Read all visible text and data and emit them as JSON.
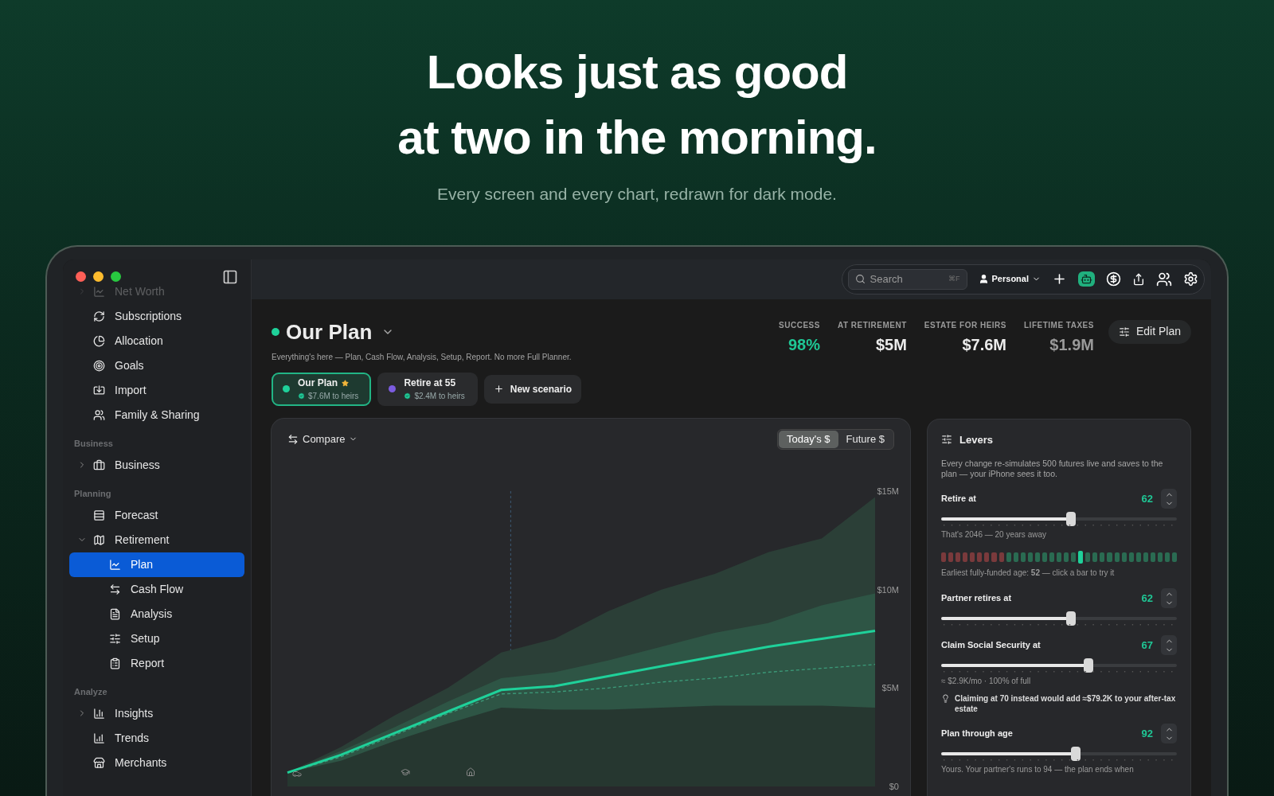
{
  "hero": {
    "headline": [
      "Looks just as good",
      "at two in the morning."
    ],
    "subtitle": "Every screen and every chart, redrawn for dark mode."
  },
  "sidebar": {
    "groups": [
      {
        "items": [
          {
            "label": "Net Worth",
            "dimmed": true,
            "expanded": false,
            "selected": false
          },
          {
            "label": "Subscriptions",
            "selected": false
          },
          {
            "label": "Allocation",
            "selected": false
          },
          {
            "label": "Goals",
            "selected": false
          },
          {
            "label": "Import",
            "selected": false
          },
          {
            "label": "Family & Sharing",
            "selected": false
          }
        ]
      },
      {
        "heading": "Business",
        "items": [
          {
            "label": "Business",
            "expanded": false,
            "selected": false
          }
        ]
      },
      {
        "heading": "Planning",
        "items": [
          {
            "label": "Forecast",
            "selected": false
          },
          {
            "label": "Retirement",
            "expanded": true,
            "selected": false,
            "children": [
              {
                "label": "Plan",
                "selected": true
              },
              {
                "label": "Cash Flow",
                "selected": false
              },
              {
                "label": "Analysis",
                "selected": false
              },
              {
                "label": "Setup",
                "selected": false
              },
              {
                "label": "Report",
                "selected": false
              }
            ]
          }
        ]
      },
      {
        "heading": "Analyze",
        "items": [
          {
            "label": "Insights",
            "expanded": false,
            "selected": false
          },
          {
            "label": "Trends",
            "selected": false
          },
          {
            "label": "Merchants",
            "selected": false
          }
        ]
      }
    ]
  },
  "toolbar": {
    "search": {
      "placeholder": "Search",
      "shortcut": "⌘F"
    },
    "profile": "Personal"
  },
  "plan": {
    "title": "Our Plan",
    "subtitle": "Everything's here — Plan, Cash Flow, Analysis, Setup, Report. No more Full Planner.",
    "stats": [
      {
        "label": "SUCCESS",
        "value": "98%",
        "color": "#1fc795"
      },
      {
        "label": "AT RETIREMENT",
        "value": "$5M",
        "color": "#ececec"
      },
      {
        "label": "ESTATE FOR HEIRS",
        "value": "$7.6M",
        "color": "#ececec"
      },
      {
        "label": "LIFETIME TAXES",
        "value": "$1.9M",
        "color": "#9a9a9a"
      }
    ],
    "edit_button": "Edit Plan"
  },
  "scenarios": [
    {
      "name": "Our Plan",
      "starred": true,
      "detail": "$7.6M to heirs",
      "color": "#1fd19a",
      "selected": true
    },
    {
      "name": "Retire at 55",
      "starred": false,
      "detail": "$2.4M to heirs",
      "color": "#7c5ce0",
      "selected": false
    }
  ],
  "new_scenario": "New scenario",
  "chart_card": {
    "compare": "Compare",
    "toggle": [
      {
        "label": "Today's $",
        "selected": true
      },
      {
        "label": "Future $",
        "selected": false
      }
    ],
    "chart_data": {
      "type": "area",
      "ylim": [
        0,
        15000000
      ],
      "yticks": [
        {
          "value": 0,
          "label": "$0"
        },
        {
          "value": 5000000,
          "label": "$5M"
        },
        {
          "value": 10000000,
          "label": "$10M"
        },
        {
          "value": 15000000,
          "label": "$15M"
        }
      ],
      "series": [
        {
          "type": "area",
          "color": "#2b3f37",
          "values": [
            700000,
            2000000,
            3600000,
            5000000,
            6800000,
            7500000,
            8900000,
            10000000,
            10800000,
            11900000,
            12600000,
            14700000
          ]
        },
        {
          "type": "area",
          "color": "#2e5545",
          "values": [
            700000,
            1800000,
            3000000,
            4300000,
            5500000,
            5800000,
            6400000,
            7100000,
            7800000,
            8300000,
            9200000,
            9800000
          ]
        },
        {
          "type": "area",
          "color": "#263730",
          "values": [
            700000,
            1300000,
            2300000,
            3200000,
            4000000,
            3900000,
            3900000,
            4000000,
            4100000,
            4100000,
            4100000,
            4000000
          ]
        },
        {
          "type": "line",
          "line_style": "dashed",
          "color": "#3c9c7a",
          "values": [
            700000,
            1500000,
            2600000,
            3700000,
            4700000,
            4800000,
            5000000,
            5300000,
            5500000,
            5800000,
            6000000,
            6200000
          ]
        },
        {
          "type": "line",
          "line_style": "solid",
          "color": "#1fd19a",
          "values": [
            700000,
            1600000,
            2700000,
            3800000,
            4900000,
            5100000,
            5600000,
            6100000,
            6600000,
            7100000,
            7500000,
            7900000
          ]
        }
      ]
    }
  },
  "levers": {
    "title": "Levers",
    "description": "Every change re-simulates 500 futures live and saves to the plan — your iPhone sees it too.",
    "items": [
      {
        "label": "Retire at",
        "value": "62",
        "level": 0.55,
        "note": "That's 2046 — 20 years away",
        "funded_bars": [
          {
            "funded": false,
            "selected": false
          },
          {
            "funded": false,
            "selected": false
          },
          {
            "funded": false,
            "selected": false
          },
          {
            "funded": false,
            "selected": false
          },
          {
            "funded": false,
            "selected": false
          },
          {
            "funded": false,
            "selected": false
          },
          {
            "funded": false,
            "selected": false
          },
          {
            "funded": false,
            "selected": false
          },
          {
            "funded": false,
            "selected": false
          },
          {
            "funded": true,
            "selected": false
          },
          {
            "funded": true,
            "selected": false
          },
          {
            "funded": true,
            "selected": false
          },
          {
            "funded": true,
            "selected": false
          },
          {
            "funded": true,
            "selected": false
          },
          {
            "funded": true,
            "selected": false
          },
          {
            "funded": true,
            "selected": false
          },
          {
            "funded": true,
            "selected": false
          },
          {
            "funded": true,
            "selected": false
          },
          {
            "funded": true,
            "selected": false
          },
          {
            "funded": true,
            "selected": true
          },
          {
            "funded": true,
            "selected": false
          },
          {
            "funded": true,
            "selected": false
          },
          {
            "funded": true,
            "selected": false
          },
          {
            "funded": true,
            "selected": false
          },
          {
            "funded": true,
            "selected": false
          },
          {
            "funded": true,
            "selected": false
          },
          {
            "funded": true,
            "selected": false
          },
          {
            "funded": true,
            "selected": false
          },
          {
            "funded": true,
            "selected": false
          },
          {
            "funded": true,
            "selected": false
          },
          {
            "funded": true,
            "selected": false
          },
          {
            "funded": true,
            "selected": false
          },
          {
            "funded": true,
            "selected": false
          }
        ],
        "bars_caption": "Earliest fully-funded age: **52** — click a bar to try it"
      },
      {
        "label": "Partner retires at",
        "value": "62",
        "level": 0.55
      },
      {
        "label": "Claim Social Security at",
        "value": "67",
        "level": 0.625,
        "note": "≈ $2.9K/mo · 100% of full",
        "tip": "Claiming at 70 instead would add ≈$79.2K to your after-tax estate"
      },
      {
        "label": "Plan through age",
        "value": "92",
        "level": 0.57,
        "note": "Yours. Your partner's runs to 94 — the plan ends when"
      }
    ]
  }
}
